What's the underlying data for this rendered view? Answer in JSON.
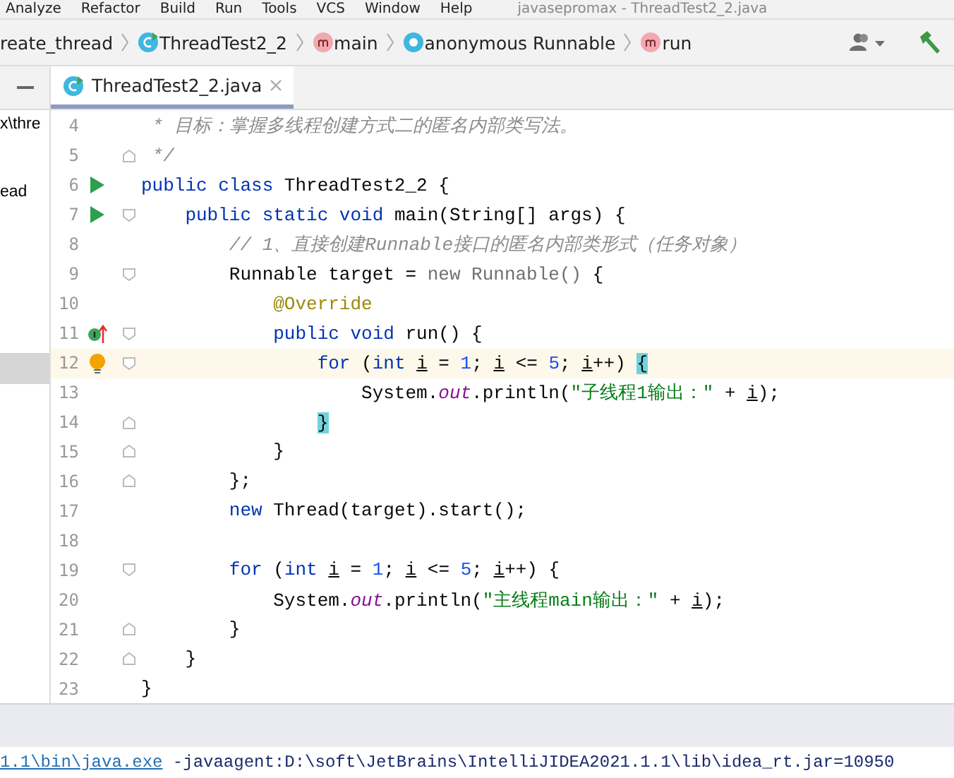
{
  "menu_bar": {
    "items": [
      "Analyze",
      "Refactor",
      "Build",
      "Run",
      "Tools",
      "VCS",
      "Window",
      "Help"
    ],
    "title": "javasepromax - ThreadTest2_2.java"
  },
  "breadcrumbs": [
    {
      "kind": "plain",
      "label": "reate_thread"
    },
    {
      "kind": "class",
      "label": "ThreadTest2_2"
    },
    {
      "kind": "method",
      "label": "main"
    },
    {
      "kind": "anonymous",
      "label": "anonymous Runnable"
    },
    {
      "kind": "method",
      "label": "run"
    }
  ],
  "tabs": [
    {
      "label": "ThreadTest2_2.java",
      "selected": true
    }
  ],
  "project_panel": {
    "items": [
      {
        "label": "x\\thre",
        "selected": false
      },
      {
        "label": "ead",
        "selected": false
      },
      {
        "selected": true
      }
    ]
  },
  "editor": {
    "lines": [
      {
        "number": "4",
        "current": false,
        "tokens": [
          {
            "kind": "comment",
            "text": " * 目标：掌握多线程创建方式二的匿名内部类写法。"
          }
        ]
      },
      {
        "number": "5",
        "fold": {
          "kind": "end"
        },
        "current": false,
        "tokens": [
          {
            "kind": "comment",
            "text": " */"
          }
        ]
      },
      {
        "number": "6",
        "gutter_icon": {
          "kind": "run"
        },
        "current": false,
        "tokens": [
          {
            "kind": "keyword",
            "text": "public class "
          },
          {
            "kind": "plain",
            "text": "ThreadTest2_2 {"
          }
        ]
      },
      {
        "number": "7",
        "gutter_icon": {
          "kind": "run"
        },
        "fold": {
          "kind": "start"
        },
        "current": false,
        "tokens": [
          {
            "kind": "keyword",
            "text": "    public static void "
          },
          {
            "kind": "plain",
            "text": "main(String[] args) {"
          }
        ]
      },
      {
        "number": "8",
        "current": false,
        "tokens": [
          {
            "kind": "comment",
            "text": "        // 1、直接创建Runnable接口的匿名内部类形式（任务对象）"
          }
        ]
      },
      {
        "number": "9",
        "fold": {
          "kind": "start"
        },
        "current": false,
        "tokens": [
          {
            "kind": "plain",
            "text": "        Runnable target = "
          },
          {
            "kind": "muted",
            "text": "new Runnable() "
          },
          {
            "kind": "plain",
            "text": "{"
          }
        ]
      },
      {
        "number": "10",
        "current": false,
        "tokens": [
          {
            "kind": "annotation",
            "text": "            @Override"
          }
        ]
      },
      {
        "number": "11",
        "gutter_icon": {
          "kind": "implements"
        },
        "fold": {
          "kind": "start"
        },
        "current": false,
        "tokens": [
          {
            "kind": "keyword",
            "text": "            public void "
          },
          {
            "kind": "plain",
            "text": "run() {"
          }
        ]
      },
      {
        "number": "12",
        "gutter_icon": {
          "kind": "bulb"
        },
        "fold": {
          "kind": "start"
        },
        "current": true,
        "tokens": [
          {
            "kind": "keyword",
            "text": "                for "
          },
          {
            "kind": "plain",
            "text": "("
          },
          {
            "kind": "keyword",
            "text": "int "
          },
          {
            "kind": "var",
            "text": "i"
          },
          {
            "kind": "plain",
            "text": " = "
          },
          {
            "kind": "number",
            "text": "1"
          },
          {
            "kind": "plain",
            "text": "; "
          },
          {
            "kind": "var",
            "text": "i"
          },
          {
            "kind": "plain",
            "text": " <= "
          },
          {
            "kind": "number",
            "text": "5"
          },
          {
            "kind": "plain",
            "text": "; "
          },
          {
            "kind": "var",
            "text": "i"
          },
          {
            "kind": "plain",
            "text": "++) "
          },
          {
            "kind": "brace_match",
            "text": "{"
          }
        ]
      },
      {
        "number": "13",
        "current": false,
        "tokens": [
          {
            "kind": "plain",
            "text": "                    System."
          },
          {
            "kind": "field",
            "text": "out"
          },
          {
            "kind": "plain",
            "text": ".println("
          },
          {
            "kind": "string",
            "text": "\"子线程1输出：\""
          },
          {
            "kind": "plain",
            "text": " + "
          },
          {
            "kind": "var",
            "text": "i"
          },
          {
            "kind": "plain",
            "text": ");"
          }
        ]
      },
      {
        "number": "14",
        "fold": {
          "kind": "end"
        },
        "current": false,
        "tokens": [
          {
            "kind": "brace_match",
            "text": "                }"
          }
        ]
      },
      {
        "number": "15",
        "fold": {
          "kind": "end"
        },
        "current": false,
        "tokens": [
          {
            "kind": "plain",
            "text": "            }"
          }
        ]
      },
      {
        "number": "16",
        "fold": {
          "kind": "end"
        },
        "current": false,
        "tokens": [
          {
            "kind": "plain",
            "text": "        };"
          }
        ]
      },
      {
        "number": "17",
        "current": false,
        "tokens": [
          {
            "kind": "keyword",
            "text": "        new "
          },
          {
            "kind": "plain",
            "text": "Thread(target).start();"
          }
        ]
      },
      {
        "number": "18",
        "current": false
      },
      {
        "number": "19",
        "fold": {
          "kind": "start"
        },
        "current": false,
        "tokens": [
          {
            "kind": "keyword",
            "text": "        for "
          },
          {
            "kind": "plain",
            "text": "("
          },
          {
            "kind": "keyword",
            "text": "int "
          },
          {
            "kind": "var",
            "text": "i"
          },
          {
            "kind": "plain",
            "text": " = "
          },
          {
            "kind": "number",
            "text": "1"
          },
          {
            "kind": "plain",
            "text": "; "
          },
          {
            "kind": "var",
            "text": "i"
          },
          {
            "kind": "plain",
            "text": " <= "
          },
          {
            "kind": "number",
            "text": "5"
          },
          {
            "kind": "plain",
            "text": "; "
          },
          {
            "kind": "var",
            "text": "i"
          },
          {
            "kind": "plain",
            "text": "++) {"
          }
        ]
      },
      {
        "number": "20",
        "current": false,
        "tokens": [
          {
            "kind": "plain",
            "text": "            System."
          },
          {
            "kind": "field",
            "text": "out"
          },
          {
            "kind": "plain",
            "text": ".println("
          },
          {
            "kind": "string",
            "text": "\"主线程main输出：\""
          },
          {
            "kind": "plain",
            "text": " + "
          },
          {
            "kind": "var",
            "text": "i"
          },
          {
            "kind": "plain",
            "text": ");"
          }
        ]
      },
      {
        "number": "21",
        "fold": {
          "kind": "end"
        },
        "current": false,
        "tokens": [
          {
            "kind": "plain",
            "text": "        }"
          }
        ]
      },
      {
        "number": "22",
        "fold": {
          "kind": "end"
        },
        "current": false,
        "tokens": [
          {
            "kind": "plain",
            "text": "    }"
          }
        ]
      },
      {
        "number": "23",
        "current": false,
        "tokens": [
          {
            "kind": "plain",
            "text": "}"
          }
        ]
      }
    ]
  },
  "console": {
    "link": "1.1\\bin\\java.exe",
    "text": " -javaagent:D:\\soft\\JetBrains\\IntelliJIDEA2021.1.1\\lib\\idea_rt.jar=10950"
  }
}
